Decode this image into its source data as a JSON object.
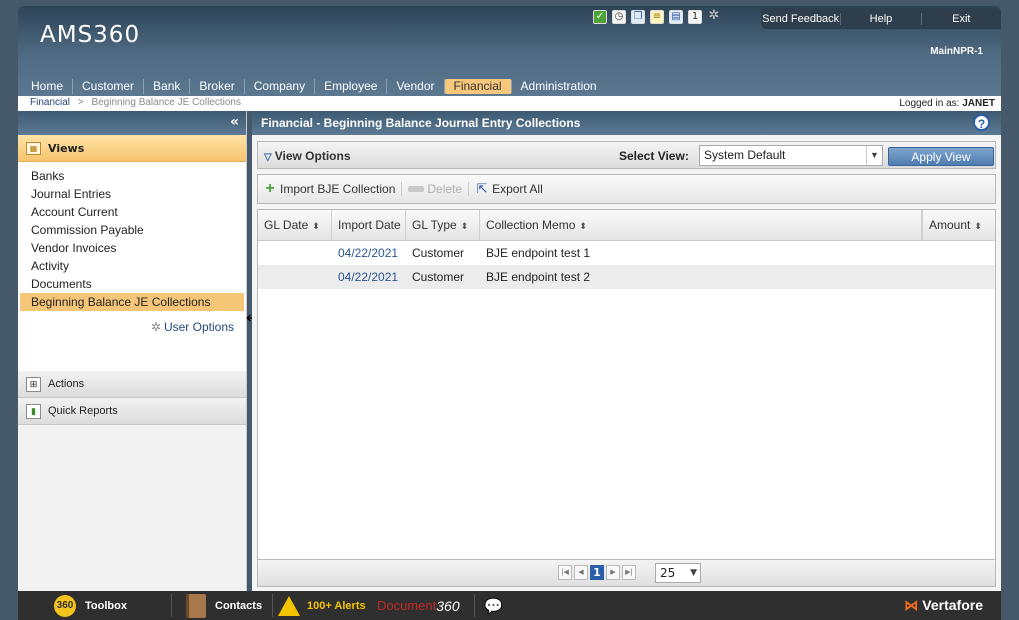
{
  "app": {
    "title": "AMS360",
    "environment": "MainNPR-1"
  },
  "topbar": {
    "send_feedback": "Send Feedback",
    "help": "Help",
    "exit": "Exit"
  },
  "toolicons": [
    "check-icon",
    "clock-icon",
    "copy-icon",
    "notes-icon",
    "document-icon",
    "calendar-icon",
    "gear-icon"
  ],
  "nav": {
    "items": [
      "Home",
      "Customer",
      "Bank",
      "Broker",
      "Company",
      "Employee",
      "Vendor",
      "Financial",
      "Administration"
    ],
    "active": "Financial"
  },
  "breadcrumb": {
    "root": "Financial",
    "separator": ">",
    "current": "Beginning Balance JE Collections"
  },
  "user": {
    "logged_label": "Logged in as:",
    "name": "JANET"
  },
  "sidebar": {
    "collapse": "«",
    "views_label": "Views",
    "views": [
      "Banks",
      "Journal Entries",
      "Account Current",
      "Commission Payable",
      "Vendor Invoices",
      "Activity",
      "Documents",
      "Beginning Balance JE Collections"
    ],
    "selected_view": "Beginning Balance JE Collections",
    "user_options": "User Options",
    "actions_label": "Actions",
    "quick_reports_label": "Quick Reports"
  },
  "main": {
    "title": "Financial - Beginning Balance Journal Entry Collections",
    "view_options_label": "View Options",
    "select_view_label": "Select View:",
    "select_view_value": "System Default",
    "apply_view": "Apply View",
    "toolbar": {
      "import": "Import BJE Collection",
      "delete": "Delete",
      "export": "Export All"
    },
    "columns": [
      "GL Date",
      "Import Date",
      "GL Type",
      "Collection Memo",
      "Amount"
    ],
    "rows": [
      {
        "gl_date": "",
        "import_date": "04/22/2021",
        "gl_type": "Customer",
        "memo": "BJE endpoint test 1",
        "amount": ""
      },
      {
        "gl_date": "",
        "import_date": "04/22/2021",
        "gl_type": "Customer",
        "memo": "BJE endpoint test 2",
        "amount": ""
      }
    ],
    "pager": {
      "current_page": "1",
      "page_size": "25"
    }
  },
  "bottombar": {
    "toolbox": "Toolbox",
    "toolbox_badge": "360",
    "contacts": "Contacts",
    "alerts": "100+ Alerts",
    "document_word": "Document",
    "document_num": "360",
    "brand": "Vertafore"
  },
  "colors": {
    "accent": "#f7c87b",
    "header": "#4f6b83",
    "link": "#2b5593",
    "apply": "#4f7cb0"
  }
}
